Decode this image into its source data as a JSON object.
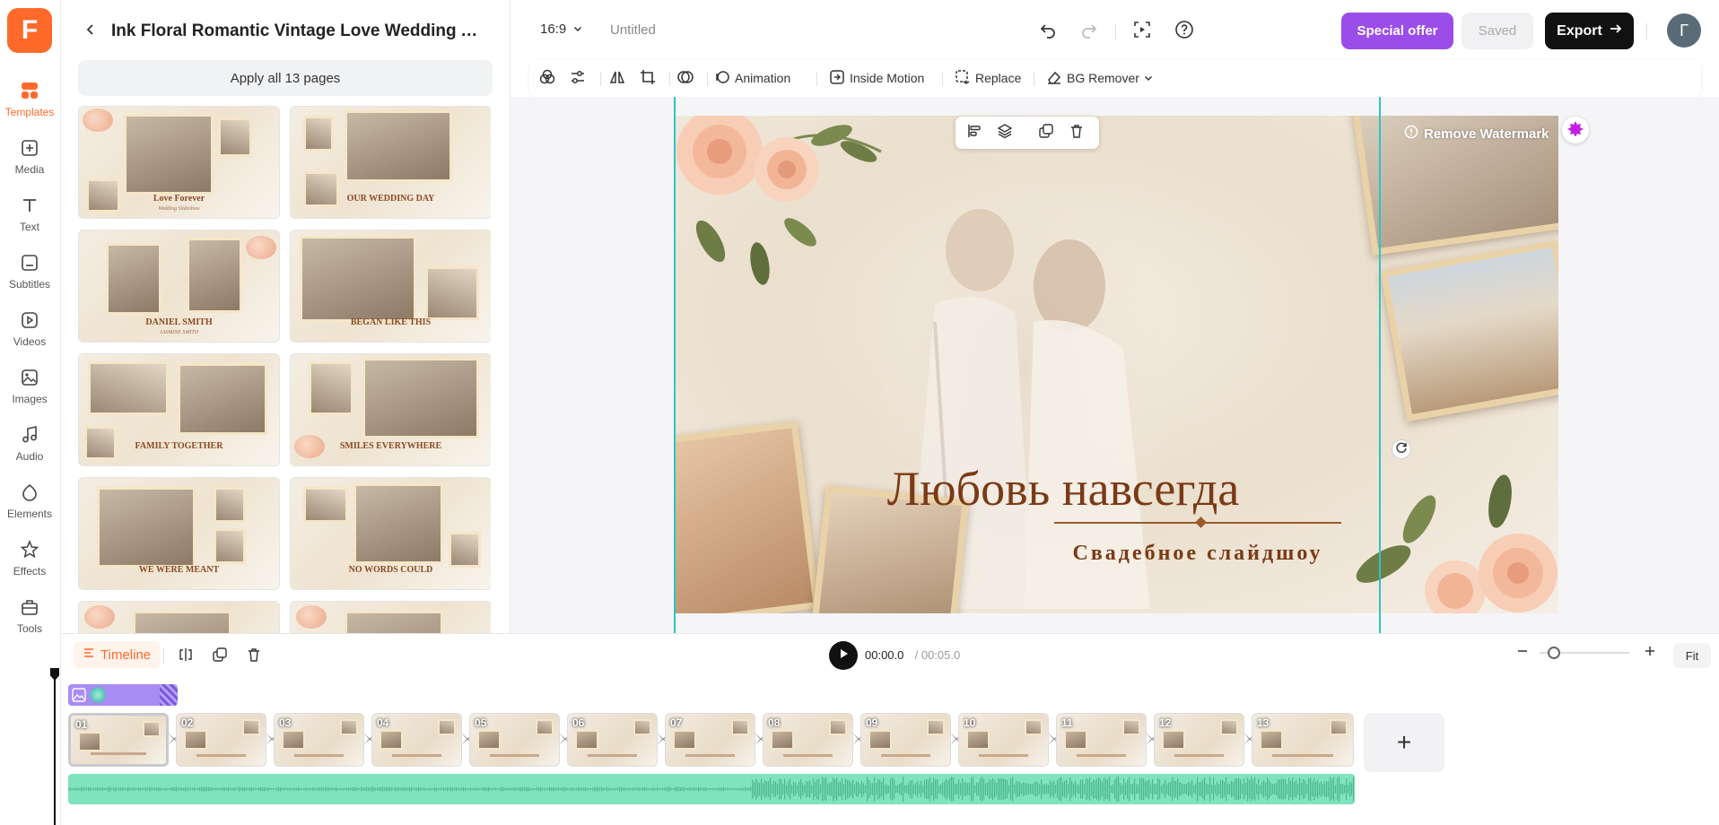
{
  "app": {
    "logo": "F",
    "accent": "#ff6a2b"
  },
  "rail": {
    "items": [
      {
        "label": "Templates",
        "icon": "templates-icon",
        "active": true
      },
      {
        "label": "Media",
        "icon": "media-icon"
      },
      {
        "label": "Text",
        "icon": "text-icon"
      },
      {
        "label": "Subtitles",
        "icon": "subtitles-icon"
      },
      {
        "label": "Videos",
        "icon": "videos-icon"
      },
      {
        "label": "Images",
        "icon": "images-icon"
      },
      {
        "label": "Audio",
        "icon": "audio-icon"
      },
      {
        "label": "Elements",
        "icon": "elements-icon"
      },
      {
        "label": "Effects",
        "icon": "effects-icon"
      },
      {
        "label": "Tools",
        "icon": "tools-icon"
      }
    ]
  },
  "panel": {
    "title": "Ink Floral Romantic Vintage Love Wedding Ann...",
    "apply_label": "Apply all 13 pages",
    "thumbnails": [
      {
        "caption": "Love Forever",
        "sub": "Wedding Slideshow"
      },
      {
        "caption": "OUR WEDDING DAY",
        "sub": ""
      },
      {
        "caption": "DANIEL SMITH",
        "sub": "JASMINE SMITH"
      },
      {
        "caption": "BEGAN LIKE THIS",
        "sub": ""
      },
      {
        "caption": "FAMILY TOGETHER",
        "sub": ""
      },
      {
        "caption": "SMILES EVERYWHERE",
        "sub": ""
      },
      {
        "caption": "WE WERE MEANT",
        "sub": ""
      },
      {
        "caption": "NO WORDS COULD",
        "sub": ""
      },
      {
        "caption": "",
        "sub": ""
      },
      {
        "caption": "",
        "sub": ""
      }
    ]
  },
  "topbar": {
    "ratio": "16:9",
    "doc_title": "Untitled",
    "special_offer": "Special offer",
    "saved": "Saved",
    "export": "Export",
    "avatar_letter": "Г",
    "offer_color": "#9b4dea"
  },
  "toolbar": {
    "animation": "Animation",
    "inside_motion": "Inside Motion",
    "replace": "Replace",
    "bg_remover": "BG Remover"
  },
  "canvas": {
    "title": "Любовь навсегда",
    "subtitle": "Свадебное слайдшоу",
    "watermark": "Remove Watermark",
    "title_color": "#7a3a16"
  },
  "timeline": {
    "tab": "Timeline",
    "time_current": "00:00.0",
    "time_separator": " / ",
    "time_total": "00:05.0",
    "fit": "Fit",
    "clips": [
      "01",
      "02",
      "03",
      "04",
      "05",
      "06",
      "07",
      "08",
      "09",
      "10",
      "11",
      "12",
      "13"
    ],
    "audio_color": "#7fe3bd"
  }
}
